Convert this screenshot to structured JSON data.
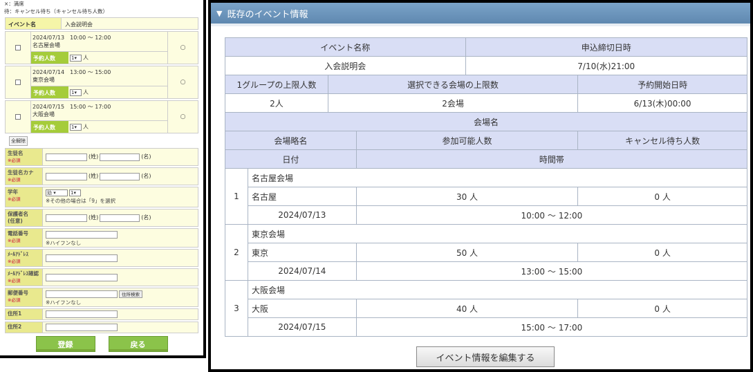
{
  "form": {
    "legend_full": "×：満席",
    "legend_wait": "待：キャンセル待ち（キャンセル待ち人数）",
    "event_name_label": "イベント名",
    "event_name_value": "入会説明会",
    "sessions": [
      {
        "date_time": "2024/07/13　10:00 ～ 12:00",
        "venue": "名古屋会場",
        "count_label": "予約人数",
        "count_value": "1",
        "unit": "人",
        "mark": "○"
      },
      {
        "date_time": "2024/07/14　13:00 ～ 15:00",
        "venue": "東京会場",
        "count_label": "予約人数",
        "count_value": "1",
        "unit": "人",
        "mark": "○"
      },
      {
        "date_time": "2024/07/15　15:00 ～ 17:00",
        "venue": "大阪会場",
        "count_label": "予約人数",
        "count_value": "1",
        "unit": "人",
        "mark": "○"
      }
    ],
    "clear_all_button": "全解除",
    "fields": {
      "student_name": {
        "label": "生徒名",
        "req": "※必須",
        "sei": "(姓)",
        "mei": "(名)"
      },
      "student_kana": {
        "label": "生徒名カナ",
        "req": "※必須",
        "sei": "(姓)",
        "mei": "(名)"
      },
      "grade": {
        "label": "学年",
        "req": "※必須",
        "select1": "幼",
        "select2": "1",
        "hint": "※その他の場合は「9」を選択"
      },
      "guardian": {
        "label": "保護者名",
        "label2": "(任意)",
        "sei": "(姓)",
        "mei": "(名)"
      },
      "phone": {
        "label": "電話番号",
        "req": "※必須",
        "hint": "※ハイフンなし"
      },
      "email": {
        "label": "ﾒｰﾙｱﾄﾞﾚｽ",
        "req": "※必須"
      },
      "email_confirm": {
        "label": "ﾒｰﾙｱﾄﾞﾚｽ確認",
        "req": "※必須"
      },
      "postal": {
        "label": "郵便番号",
        "req": "※必須",
        "search_button": "住所検索",
        "hint": "※ハイフンなし"
      },
      "address1": {
        "label": "住所1"
      },
      "address2": {
        "label": "住所2"
      }
    },
    "register_button": "登録",
    "back_button": "戻る"
  },
  "event_info": {
    "header": "既存のイベント情報",
    "h_event_name": "イベント名称",
    "h_deadline": "申込締切日時",
    "event_name": "入会説明会",
    "deadline": "7/10(水)21:00",
    "h_group_limit": "1グループの上限人数",
    "h_venue_limit": "選択できる会場の上限数",
    "h_reserve_start": "予約開始日時",
    "group_limit": "2人",
    "venue_limit": "2会場",
    "reserve_start": "6/13(木)00:00",
    "h_venue_name": "会場名",
    "h_venue_short": "会場略名",
    "h_capacity": "参加可能人数",
    "h_waitlist": "キャンセル待ち人数",
    "h_date": "日付",
    "h_time": "時間帯",
    "venues": [
      {
        "no": "1",
        "name": "名古屋会場",
        "short": "名古屋",
        "capacity": "30 人",
        "waitlist": "0 人",
        "date": "2024/07/13",
        "time": "10:00 ～ 12:00"
      },
      {
        "no": "2",
        "name": "東京会場",
        "short": "東京",
        "capacity": "50 人",
        "waitlist": "0 人",
        "date": "2024/07/14",
        "time": "13:00 ～ 15:00"
      },
      {
        "no": "3",
        "name": "大阪会場",
        "short": "大阪",
        "capacity": "40 人",
        "waitlist": "0 人",
        "date": "2024/07/15",
        "time": "15:00 ～ 17:00"
      }
    ],
    "edit_button": "イベント情報を編集する"
  }
}
